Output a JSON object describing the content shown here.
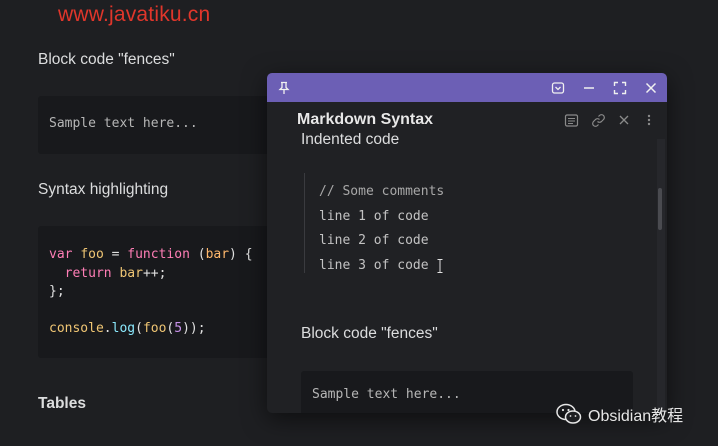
{
  "watermark": {
    "text": "www.javatiku.cn"
  },
  "note": {
    "heading_fences": "Block code \"fences\"",
    "sample_text": "Sample text here...",
    "heading_syntax": "Syntax highlighting",
    "heading_tables": "Tables"
  },
  "popout": {
    "titlebar_color": "#6c5fb5",
    "view_title": "Markdown Syntax",
    "heading_indented": "Indented code",
    "indented_lines": [
      "// Some comments",
      "line 1 of code",
      "line 2 of code",
      "line 3 of code"
    ],
    "heading_fences": "Block code \"fences\"",
    "sample_text": "Sample text here..."
  },
  "badge": {
    "text": "Obsidian教程"
  }
}
